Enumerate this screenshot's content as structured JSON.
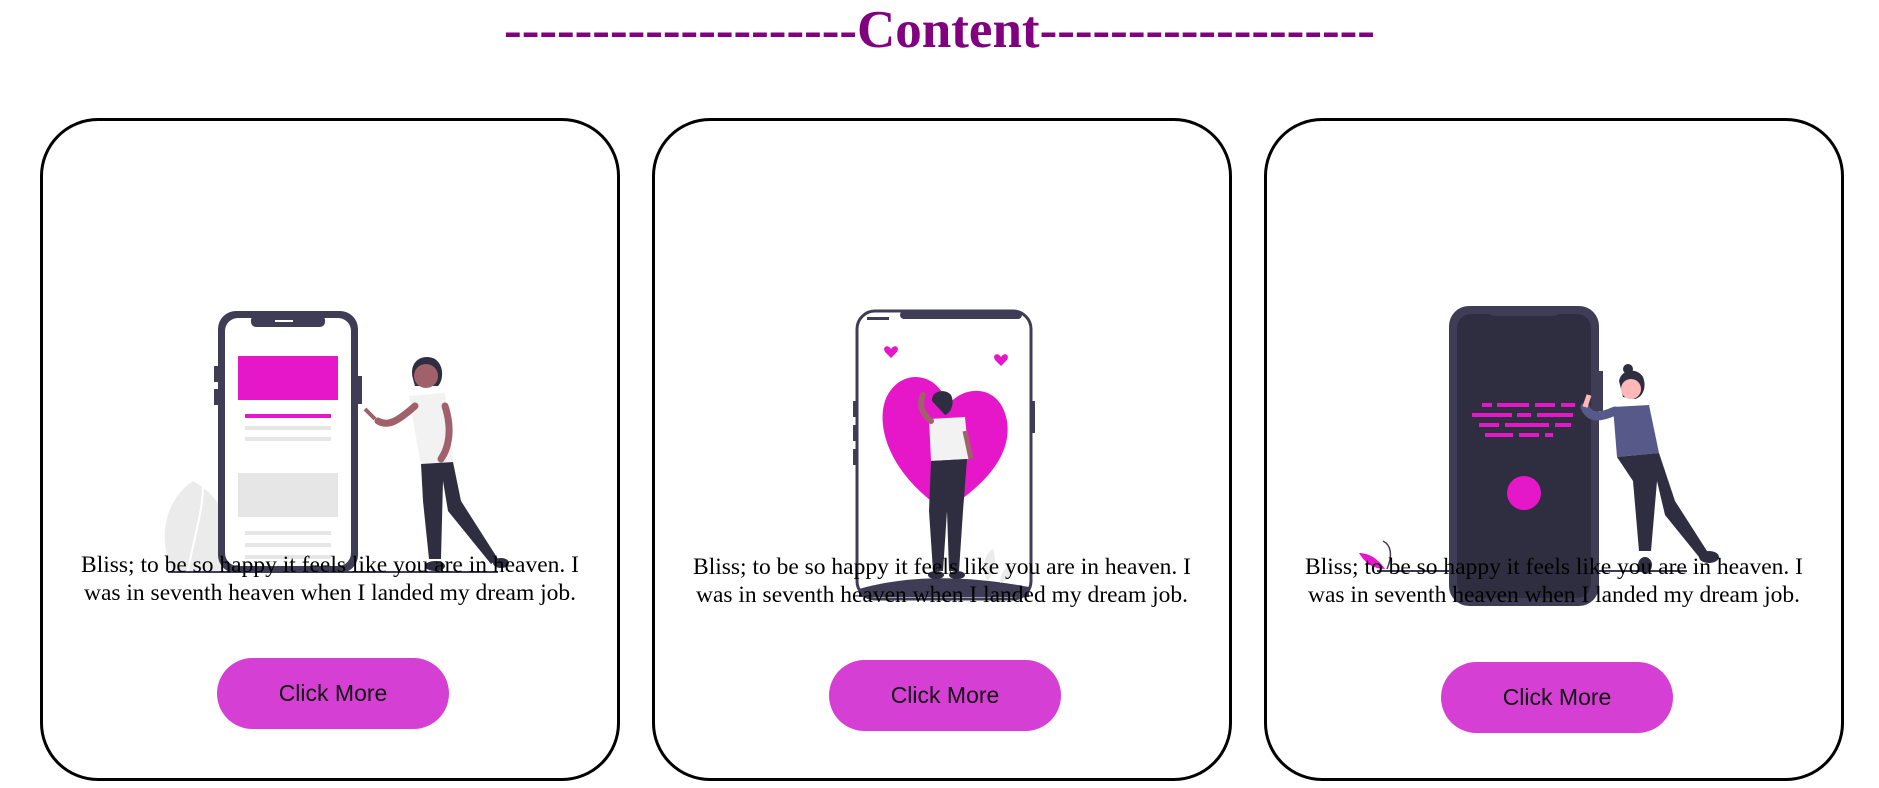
{
  "header": {
    "title": "--------------------Content-------------------"
  },
  "colors": {
    "accent": "#e616c9",
    "button": "#d63fd3",
    "title": "#800080",
    "dark": "#3f3d56"
  },
  "cards": [
    {
      "illustration": "woman-tapping-phone-illustration",
      "description": "Bliss; to be so happy it feels like you are in heaven. I was in seventh heaven when I landed my dream job.",
      "button_label": "Click More"
    },
    {
      "illustration": "woman-with-heart-in-phone-illustration",
      "description": "Bliss; to be so happy it feels like you are in heaven. I was in seventh heaven when I landed my dream job.",
      "button_label": "Click More"
    },
    {
      "illustration": "woman-beside-dark-phone-illustration",
      "description": "Bliss; to be so happy it feels like you are in heaven. I was in seventh heaven when I landed my dream job.",
      "button_label": "Click More"
    }
  ]
}
